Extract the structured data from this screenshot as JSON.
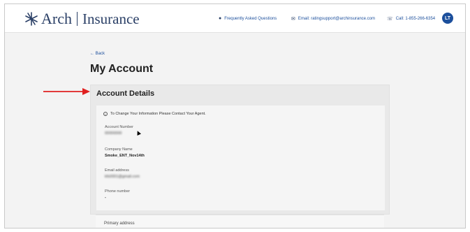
{
  "header": {
    "logo_text_arch": "Arch",
    "logo_text_insurance": "Insurance",
    "faq_label": "Frequently Asked Questions",
    "email_label": "Email: ratingsupport@archinsurance.com",
    "call_label": "Call: 1-855-266-6354",
    "avatar_initials": "LT"
  },
  "nav": {
    "back_label": "← Back"
  },
  "page": {
    "title": "My Account"
  },
  "account_details": {
    "title": "Account Details",
    "info_note": "To Change Your Information Please Contact Your Agent.",
    "fields": [
      {
        "label": "Account Number",
        "value": "00000000"
      },
      {
        "label": "Company Name",
        "value": "Smoke_ENT_Nov14th"
      },
      {
        "label": "Email address",
        "value": "kfs0001@gmail.com"
      },
      {
        "label": "Phone number",
        "value": "-"
      }
    ]
  },
  "primary_address": {
    "label": "Primary address"
  },
  "colors": {
    "accent": "#1c4f9c",
    "brand_navy": "#2a3f66",
    "arrow_red": "#e02020"
  }
}
